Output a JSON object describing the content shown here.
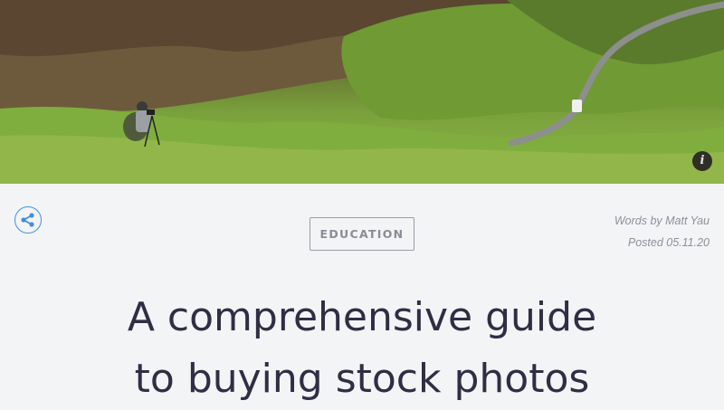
{
  "hero": {
    "alt": "Photographer on a green hillside above a winding road",
    "info_label": "i"
  },
  "share": {
    "icon": "share-icon"
  },
  "article": {
    "category": "EDUCATION",
    "author_line": "Words by Matt Yau",
    "posted_line": "Posted 05.11.20",
    "title_line1": "A comprehensive guide",
    "title_line2": "to buying stock photos"
  },
  "colors": {
    "accent": "#3f8fe0",
    "title": "#2f2e44",
    "background": "#f3f4f6"
  }
}
